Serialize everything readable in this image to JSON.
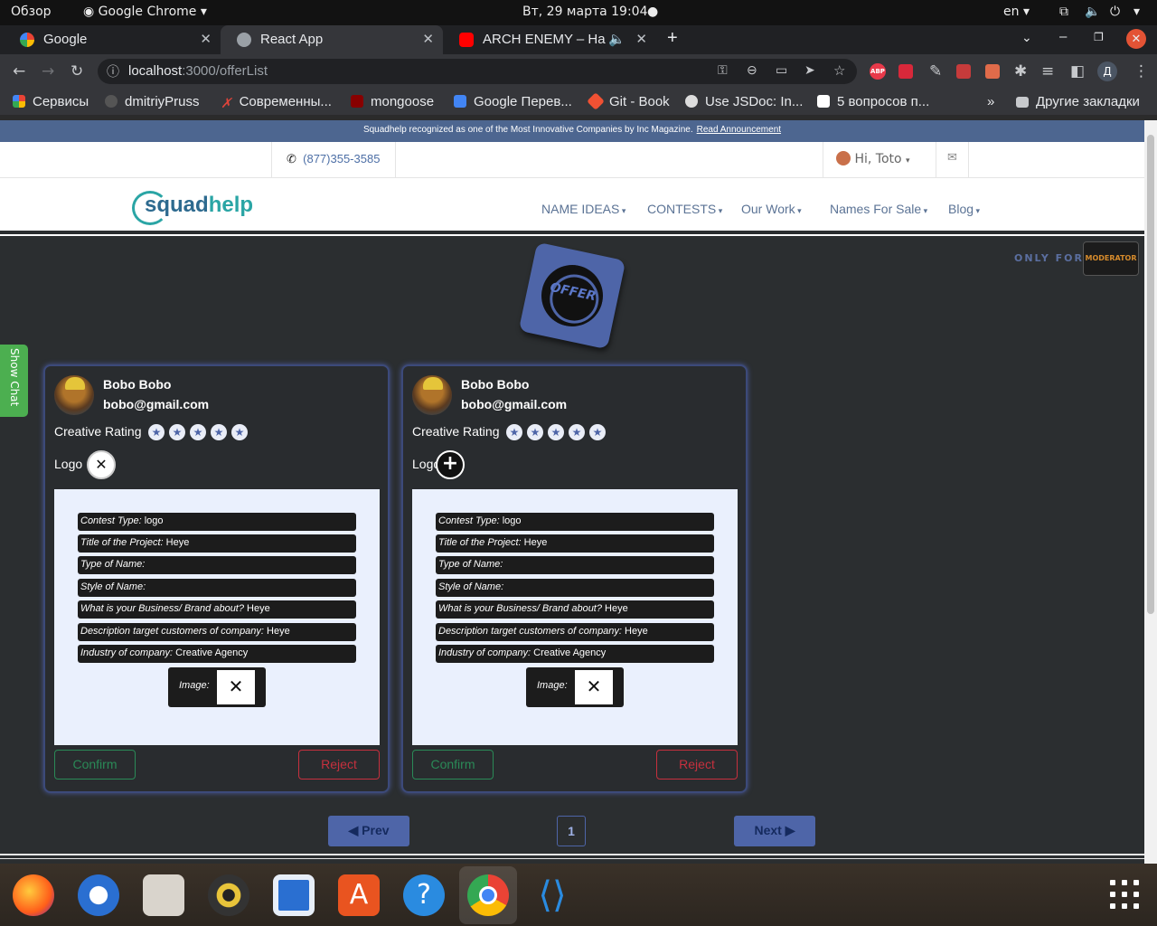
{
  "os_bar": {
    "activities": "Обзор",
    "app_name": "Google Chrome",
    "datetime": "Вт, 29 марта  19:04",
    "language": "en"
  },
  "browser": {
    "tabs": [
      {
        "label": "Google",
        "active": false
      },
      {
        "label": "React App",
        "active": true
      },
      {
        "label": "ARCH ENEMY – Hands",
        "active": false
      }
    ],
    "url_host": "localhost",
    "url_path": ":3000/offerList",
    "profile_initial": "Д",
    "bookmarks": [
      "Сервисы",
      "dmitriyPruss",
      "Современны...",
      "mongoose",
      "Google Перев...",
      "Git - Book",
      "Use JSDoc: In...",
      "5 вопросов п...",
      "»",
      "Другие закладки"
    ]
  },
  "site": {
    "announcement": "Squadhelp recognized as one of the Most Innovative Companies by Inc Magazine.",
    "announcement_link": "Read Announcement",
    "phone": "(877)355-3585",
    "greeting": "Hi, Toto",
    "logo_main": "squad",
    "logo_accent": "help",
    "nav": [
      "NAME IDEAS",
      "CONTESTS",
      "Our Work",
      "Names For Sale",
      "Blog"
    ],
    "only_for": "ONLY FOR",
    "moderator_badge": "MODERATOR",
    "offer_badge": "OFFER",
    "show_chat": "Show Chat"
  },
  "offers": [
    {
      "name": "Bobo Bobo",
      "email": "bobo@gmail.com",
      "rating_label": "Creative Rating",
      "rating": 0,
      "logo_label": "Logo",
      "fields": [
        {
          "label": "Contest Type:",
          "value": "logo"
        },
        {
          "label": "Title of the Project:",
          "value": "Heye"
        },
        {
          "label": "Type of Name:",
          "value": ""
        },
        {
          "label": "Style of Name:",
          "value": ""
        },
        {
          "label": "What is your Business/ Brand about?",
          "value": "Heye"
        },
        {
          "label": "Description target customers of company:",
          "value": "Heye"
        },
        {
          "label": "Industry of company:",
          "value": "Creative Agency"
        }
      ],
      "image_label": "Image:",
      "confirm": "Confirm",
      "reject": "Reject"
    },
    {
      "name": "Bobo Bobo",
      "email": "bobo@gmail.com",
      "rating_label": "Creative Rating",
      "rating": 0,
      "logo_label": "Logo",
      "fields": [
        {
          "label": "Contest Type:",
          "value": "logo"
        },
        {
          "label": "Title of the Project:",
          "value": "Heye"
        },
        {
          "label": "Type of Name:",
          "value": ""
        },
        {
          "label": "Style of Name:",
          "value": ""
        },
        {
          "label": "What is your Business/ Brand about?",
          "value": "Heye"
        },
        {
          "label": "Description target customers of company:",
          "value": "Heye"
        },
        {
          "label": "Industry of company:",
          "value": "Creative Agency"
        }
      ],
      "image_label": "Image:",
      "confirm": "Confirm",
      "reject": "Reject"
    }
  ],
  "pagination": {
    "prev": "Prev",
    "page": "1",
    "next": "Next"
  },
  "colors": {
    "primary": "#4e65a8",
    "confirm": "#2a8a57",
    "reject": "#c6303e",
    "chat": "#4caf50"
  }
}
